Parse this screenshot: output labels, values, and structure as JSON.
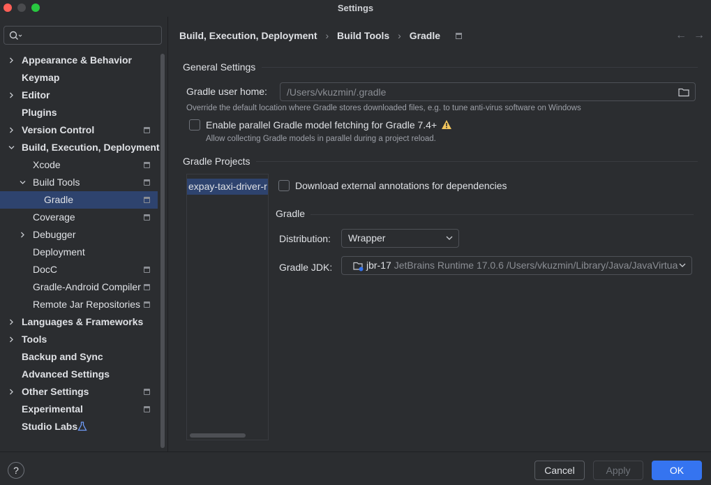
{
  "window": {
    "title": "Settings"
  },
  "sidebar": {
    "search_placeholder": "",
    "items": [
      {
        "label": "Appearance & Behavior",
        "level": 0,
        "expandable": true,
        "expanded": false,
        "project_icon": false,
        "selected": false
      },
      {
        "label": "Keymap",
        "level": 0,
        "expandable": false,
        "project_icon": false,
        "selected": false
      },
      {
        "label": "Editor",
        "level": 0,
        "expandable": true,
        "expanded": false,
        "project_icon": false,
        "selected": false
      },
      {
        "label": "Plugins",
        "level": 0,
        "expandable": false,
        "project_icon": false,
        "selected": false
      },
      {
        "label": "Version Control",
        "level": 0,
        "expandable": true,
        "expanded": false,
        "project_icon": true,
        "selected": false
      },
      {
        "label": "Build, Execution, Deployment",
        "level": 0,
        "expandable": true,
        "expanded": true,
        "project_icon": false,
        "selected": false
      },
      {
        "label": "Xcode",
        "level": 1,
        "expandable": false,
        "project_icon": true,
        "selected": false
      },
      {
        "label": "Build Tools",
        "level": 1,
        "expandable": true,
        "expanded": true,
        "project_icon": true,
        "selected": false
      },
      {
        "label": "Gradle",
        "level": 2,
        "expandable": false,
        "project_icon": true,
        "selected": true
      },
      {
        "label": "Coverage",
        "level": 1,
        "expandable": false,
        "project_icon": true,
        "selected": false
      },
      {
        "label": "Debugger",
        "level": 1,
        "expandable": true,
        "expanded": false,
        "project_icon": false,
        "selected": false
      },
      {
        "label": "Deployment",
        "level": 1,
        "expandable": false,
        "project_icon": false,
        "selected": false
      },
      {
        "label": "DocC",
        "level": 1,
        "expandable": false,
        "project_icon": true,
        "selected": false
      },
      {
        "label": "Gradle-Android Compiler",
        "level": 1,
        "expandable": false,
        "project_icon": true,
        "selected": false
      },
      {
        "label": "Remote Jar Repositories",
        "level": 1,
        "expandable": false,
        "project_icon": true,
        "selected": false
      },
      {
        "label": "Languages & Frameworks",
        "level": 0,
        "expandable": true,
        "expanded": false,
        "project_icon": false,
        "selected": false
      },
      {
        "label": "Tools",
        "level": 0,
        "expandable": true,
        "expanded": false,
        "project_icon": false,
        "selected": false
      },
      {
        "label": "Backup and Sync",
        "level": 0,
        "expandable": false,
        "project_icon": false,
        "selected": false
      },
      {
        "label": "Advanced Settings",
        "level": 0,
        "expandable": false,
        "project_icon": false,
        "selected": false
      },
      {
        "label": "Other Settings",
        "level": 0,
        "expandable": true,
        "expanded": false,
        "project_icon": true,
        "selected": false
      },
      {
        "label": "Experimental",
        "level": 0,
        "expandable": false,
        "project_icon": true,
        "selected": false
      },
      {
        "label": "Studio Labs",
        "level": 0,
        "expandable": false,
        "project_icon": false,
        "flask_icon": true,
        "selected": false
      }
    ]
  },
  "breadcrumb": [
    "Build, Execution, Deployment",
    "Build Tools",
    "Gradle"
  ],
  "general": {
    "title": "General Settings",
    "user_home_label": "Gradle user home:",
    "user_home_value": "/Users/vkuzmin/.gradle",
    "user_home_hint": "Override the default location where Gradle stores downloaded files, e.g. to tune anti-virus software on Windows",
    "parallel_label": "Enable parallel Gradle model fetching for Gradle 7.4+",
    "parallel_checked": false,
    "parallel_hint": "Allow collecting Gradle models in parallel during a project reload."
  },
  "projects": {
    "title": "Gradle Projects",
    "list": [
      "expay-taxi-driver-r"
    ],
    "download_annotations_label": "Download external annotations for dependencies",
    "download_annotations_checked": false,
    "gradle_section_title": "Gradle",
    "distribution_label": "Distribution:",
    "distribution_value": "Wrapper",
    "jdk_label": "Gradle JDK:",
    "jdk_name": "jbr-17",
    "jdk_detail": "JetBrains Runtime 17.0.6 /Users/vkuzmin/Library/Java/JavaVirtua"
  },
  "footer": {
    "help_label": "?",
    "cancel_label": "Cancel",
    "apply_label": "Apply",
    "ok_label": "OK"
  },
  "colors": {
    "accent": "#3574f0",
    "selection": "#2e436e",
    "background": "#2b2d30",
    "warning": "#f2c55c"
  }
}
